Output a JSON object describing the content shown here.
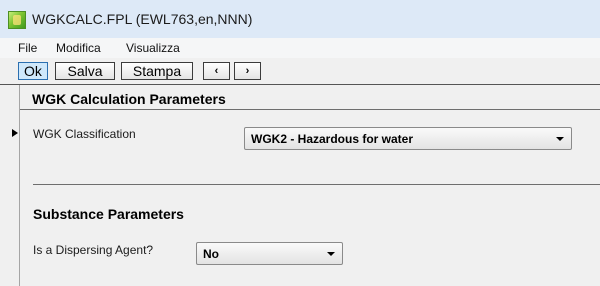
{
  "window": {
    "title": "WGKCALC.FPL (EWL763,en,NNN)",
    "icon": "app-icon"
  },
  "menu": {
    "items": [
      "File",
      "Modifica",
      "Visualizza"
    ]
  },
  "toolbar": {
    "ok_label": "Ok",
    "save_label": "Salva",
    "print_label": "Stampa",
    "prev_label": "‹",
    "next_label": "›"
  },
  "sections": {
    "wgk": {
      "title": "WGK Calculation Parameters",
      "classification_label": "WGK Classification",
      "classification_value": "WGK2 - Hazardous for water"
    },
    "substance": {
      "title": "Substance Parameters",
      "dispersing_label": "Is a Dispersing Agent?",
      "dispersing_value": "No"
    }
  }
}
